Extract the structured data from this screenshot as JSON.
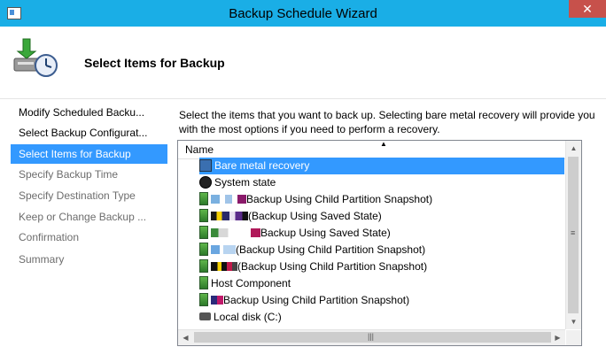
{
  "window": {
    "title": "Backup Schedule Wizard",
    "close_glyph": "✕"
  },
  "header": {
    "title": "Select Items for Backup"
  },
  "nav": {
    "items": [
      {
        "label": "Modify Scheduled Backu...",
        "state": "normal"
      },
      {
        "label": "Select Backup Configurat...",
        "state": "normal"
      },
      {
        "label": "Select Items for Backup",
        "state": "active"
      },
      {
        "label": "Specify Backup Time",
        "state": "disabled"
      },
      {
        "label": "Specify Destination Type",
        "state": "disabled"
      },
      {
        "label": "Keep or Change Backup ...",
        "state": "disabled"
      },
      {
        "label": "Confirmation",
        "state": "disabled"
      },
      {
        "label": "Summary",
        "state": "disabled"
      }
    ]
  },
  "description": "Select the items that you want to back up. Selecting bare metal recovery will provide you with the most options if you need to perform a recovery.",
  "tree": {
    "column_header": "Name",
    "items": [
      {
        "label": "Bare metal recovery",
        "icon": "bare-metal-recovery-icon",
        "selected": true
      },
      {
        "label": "System state",
        "icon": "system-state-icon"
      },
      {
        "label": "Backup Using Child Partition Snapshot)",
        "icon": "virtual-machine-icon"
      },
      {
        "label": "(Backup Using Saved State)",
        "icon": "virtual-machine-icon"
      },
      {
        "label": "Backup Using Saved State)",
        "icon": "virtual-machine-icon"
      },
      {
        "label": "(Backup Using Child Partition Snapshot)",
        "icon": "virtual-machine-icon"
      },
      {
        "label": "(Backup Using Child Partition Snapshot)",
        "icon": "virtual-machine-icon"
      },
      {
        "label": "Host Component",
        "icon": "host-component-icon"
      },
      {
        "label": "Backup Using Child Partition Snapshot)",
        "icon": "virtual-machine-icon"
      },
      {
        "label": "Local disk (C:)",
        "icon": "local-disk-icon"
      }
    ]
  },
  "scrollbars": {
    "vertical_grip": "≡",
    "horizontal_grip": "|||"
  },
  "colors": {
    "title_bar": "#1aaee6",
    "selection": "#3399ff",
    "close_button": "#c7514b"
  }
}
